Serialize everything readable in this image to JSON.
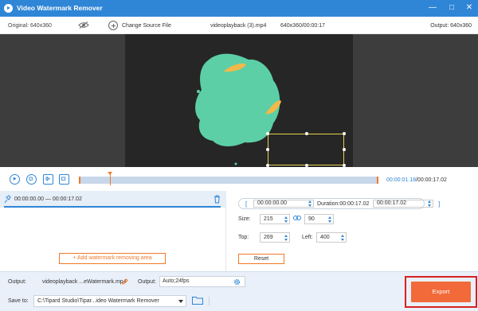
{
  "window": {
    "title": "Video Watermark Remover",
    "controls": {
      "minimize": "—",
      "maximize": "□",
      "close": "✕"
    }
  },
  "infobar": {
    "original": "Original: 640x360",
    "change_source": "Change Source File",
    "filename": "videoplayback (3).mp4",
    "file_info": "640x360/00:00:17",
    "output_res": "Output: 640x360"
  },
  "playback": {
    "current_time": "00:00:01.18",
    "total_time": "/00:00:17.02",
    "playhead_fraction": 0.1
  },
  "clips": [
    {
      "range": "00:00:00.00 — 00:00:17.02"
    }
  ],
  "left_panel": {
    "add_button": "Add watermark removing area"
  },
  "time_controls": {
    "start": "00:00:00.00",
    "duration": "Duration:00:00:17.02",
    "end": "00:00:17.02"
  },
  "region": {
    "size_label": "Size:",
    "width": "215",
    "height": "90",
    "top_label": "Top:",
    "top": "269",
    "left_label": "Left:",
    "left": "400",
    "reset": "Reset"
  },
  "output": {
    "output_label": "Output:",
    "output_name": "videoplayback ...eWatermark.mp4",
    "format_label": "Output:",
    "format": "Auto;24fps",
    "save_label": "Save to:",
    "save_path": "C:\\Tipard Studio\\Tipar...ideo Watermark Remover",
    "export": "Export"
  },
  "colors": {
    "accent": "#2f86d6",
    "orange": "#f07a2a",
    "export_bg": "#f26a39",
    "highlight": "#d82020",
    "blob": "#5ccfa6",
    "blob_marks": "#f0b94a"
  },
  "icons": [
    "app-icon",
    "eye-icon",
    "plus-circle-icon",
    "play-icon",
    "stop-icon",
    "clip-start-icon",
    "clip-end-icon",
    "pin-icon",
    "trash-icon",
    "link-icon",
    "edit-icon",
    "gear-icon",
    "folder-icon"
  ]
}
